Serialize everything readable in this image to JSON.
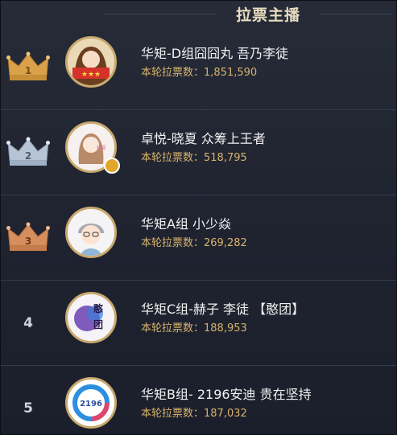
{
  "header": {
    "title": "拉票主播"
  },
  "rows": [
    {
      "rank": "1",
      "name": "华矩-D组囧囧丸 吾乃李徒",
      "votes_label": "本轮拉票数：",
      "votes": "1,851,590",
      "crown_color": "#d9a24a"
    },
    {
      "rank": "2",
      "name": "卓悦-晓夏 众筹上王者",
      "votes_label": "本轮拉票数：",
      "votes": "518,795",
      "crown_color": "#b7c4d6"
    },
    {
      "rank": "3",
      "name": "华矩A组 小少焱",
      "votes_label": "本轮拉票数：",
      "votes": "269,282",
      "crown_color": "#d58f5e"
    },
    {
      "rank": "4",
      "name": "华矩C组-赫子 李徒 【憨团】",
      "votes_label": "本轮拉票数：",
      "votes": "188,953"
    },
    {
      "rank": "5",
      "name": "华矩B组- 2196安迪 贵在坚持",
      "votes_label": "本轮拉票数：",
      "votes": "187,032"
    }
  ],
  "colors": {
    "accent_gold": "#d8b36b",
    "title": "#e7dcc0"
  }
}
